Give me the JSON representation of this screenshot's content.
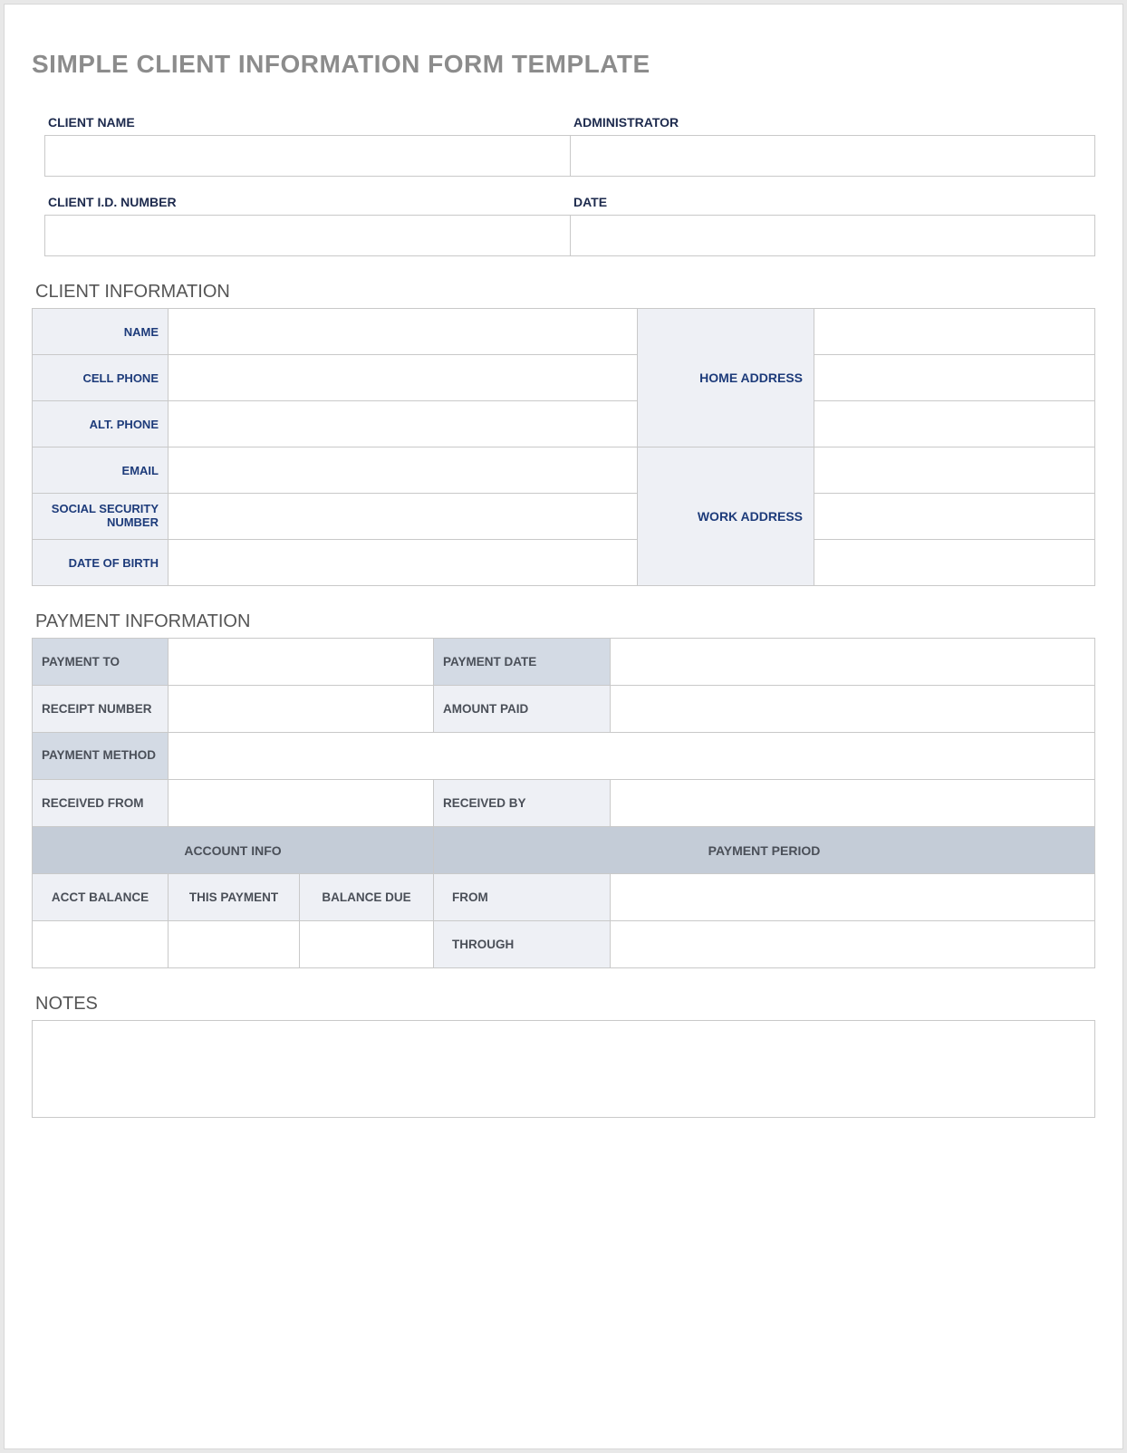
{
  "title": "SIMPLE CLIENT INFORMATION FORM TEMPLATE",
  "header": {
    "client_name_label": "CLIENT NAME",
    "administrator_label": "ADMINISTRATOR",
    "client_id_label": "CLIENT I.D. NUMBER",
    "date_label": "DATE",
    "client_name_value": "",
    "administrator_value": "",
    "client_id_value": "",
    "date_value": ""
  },
  "sections": {
    "client_info": "CLIENT INFORMATION",
    "payment_info": "PAYMENT INFORMATION",
    "notes": "NOTES"
  },
  "client_info": {
    "name_label": "NAME",
    "cell_phone_label": "CELL PHONE",
    "alt_phone_label": "ALT. PHONE",
    "email_label": "EMAIL",
    "ssn_label": "SOCIAL SECURITY NUMBER",
    "dob_label": "DATE OF BIRTH",
    "home_address_label": "HOME ADDRESS",
    "work_address_label": "WORK ADDRESS",
    "name_value": "",
    "cell_phone_value": "",
    "alt_phone_value": "",
    "email_value": "",
    "ssn_value": "",
    "dob_value": "",
    "home_address_value1": "",
    "home_address_value2": "",
    "home_address_value3": "",
    "work_address_value1": "",
    "work_address_value2": "",
    "work_address_value3": ""
  },
  "payment_info": {
    "payment_to_label": "PAYMENT TO",
    "payment_date_label": "PAYMENT DATE",
    "receipt_number_label": "RECEIPT NUMBER",
    "amount_paid_label": "AMOUNT PAID",
    "payment_method_label": "PAYMENT METHOD",
    "received_from_label": "RECEIVED FROM",
    "received_by_label": "RECEIVED BY",
    "account_info_header": "ACCOUNT INFO",
    "payment_period_header": "PAYMENT PERIOD",
    "acct_balance_label": "ACCT BALANCE",
    "this_payment_label": "THIS PAYMENT",
    "balance_due_label": "BALANCE DUE",
    "from_label": "FROM",
    "through_label": "THROUGH",
    "payment_to_value": "",
    "payment_date_value": "",
    "receipt_number_value": "",
    "amount_paid_value": "",
    "payment_method_value": "",
    "received_from_value": "",
    "received_by_value": "",
    "acct_balance_value": "",
    "this_payment_value": "",
    "balance_due_value": "",
    "from_value": "",
    "through_value": ""
  },
  "notes": {
    "value": ""
  }
}
